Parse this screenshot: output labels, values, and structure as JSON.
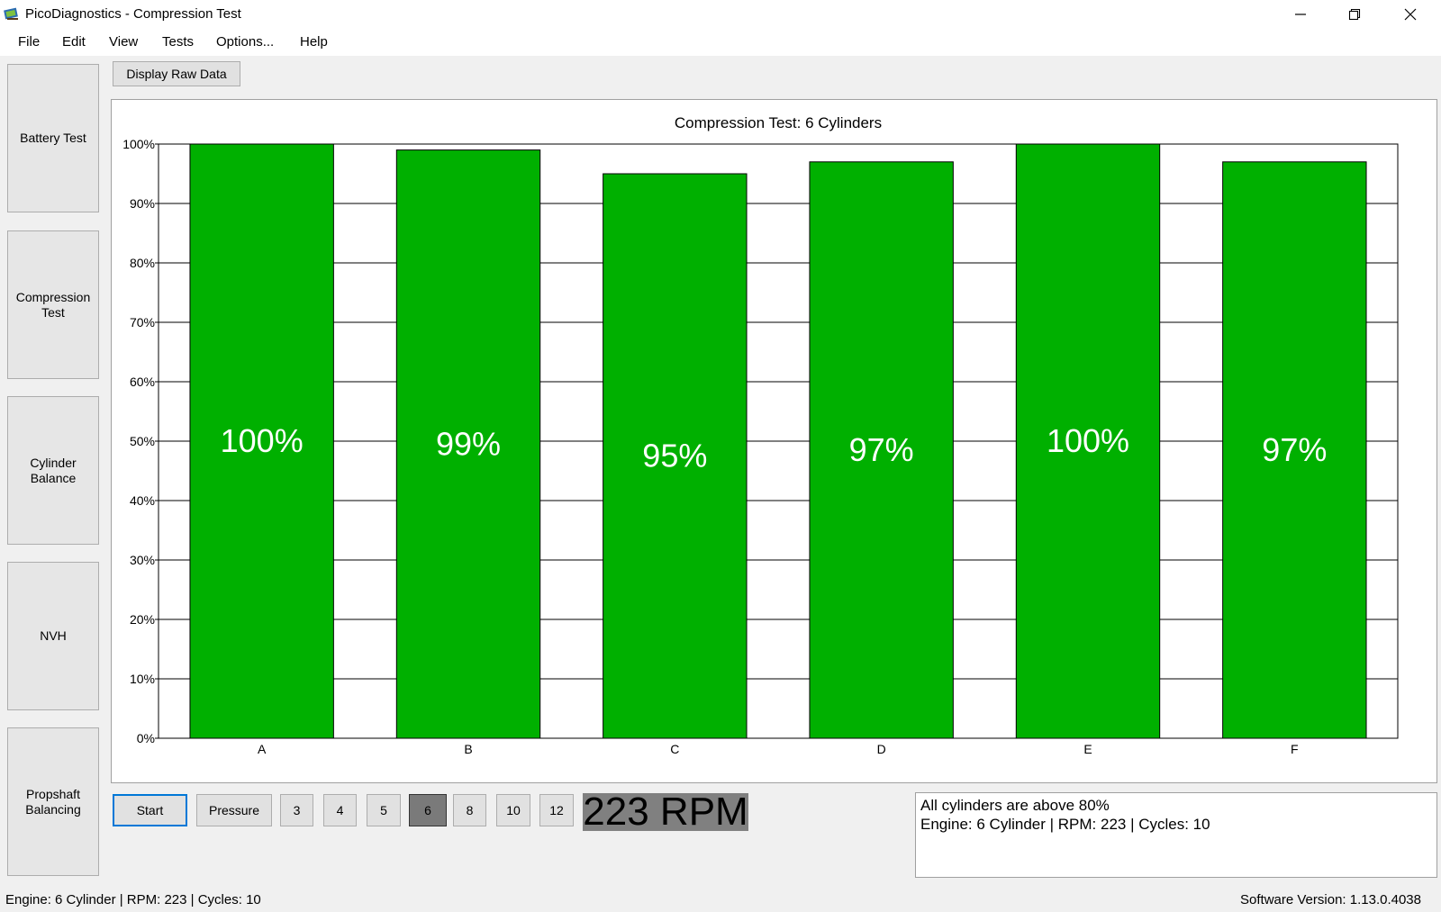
{
  "window": {
    "title": "PicoDiagnostics - Compression Test",
    "icon": "pico-app-icon",
    "controls": [
      "minimize-icon",
      "restore-icon",
      "close-icon"
    ]
  },
  "menu": [
    "File",
    "Edit",
    "View",
    "Tests",
    "Options...",
    "Help"
  ],
  "sidebar": {
    "items": [
      {
        "label": "Battery Test"
      },
      {
        "label": "Compression\nTest"
      },
      {
        "label": "Cylinder\nBalance"
      },
      {
        "label": "NVH"
      },
      {
        "label": "Propshaft\nBalancing"
      }
    ]
  },
  "toolbar": {
    "raw_data_label": "Display Raw Data"
  },
  "chart_data": {
    "type": "bar",
    "title": "Compression Test: 6 Cylinders",
    "categories": [
      "A",
      "B",
      "C",
      "D",
      "E",
      "F"
    ],
    "values": [
      100,
      99,
      95,
      97,
      100,
      97
    ],
    "data_labels": [
      "100%",
      "99%",
      "95%",
      "97%",
      "100%",
      "97%"
    ],
    "ylim": [
      0,
      100
    ],
    "yticks": [
      0,
      10,
      20,
      30,
      40,
      50,
      60,
      70,
      80,
      90,
      100
    ],
    "ytick_labels": [
      "0%",
      "10%",
      "20%",
      "30%",
      "40%",
      "50%",
      "60%",
      "70%",
      "80%",
      "90%",
      "100%"
    ],
    "xlabel": "",
    "ylabel": "",
    "grid": true,
    "bar_color": "#00b000"
  },
  "controls": {
    "start_label": "Start",
    "pressure_label": "Pressure",
    "cylinder_options": [
      "3",
      "4",
      "5",
      "6",
      "8",
      "10",
      "12"
    ],
    "selected_cylinders": "6",
    "rpm_text": "223 RPM"
  },
  "status_box": {
    "line1": "All cylinders are above 80%",
    "line2": "Engine: 6 Cylinder | RPM: 223 | Cycles: 10"
  },
  "statusbar": {
    "left": "Engine: 6 Cylinder | RPM: 223 | Cycles: 10",
    "right": "Software Version: 1.13.0.4038"
  },
  "colors": {
    "bar": "#00b000",
    "selected_button": "#7a7a7a",
    "rpm_background": "#808080",
    "start_border": "#0078d7"
  }
}
